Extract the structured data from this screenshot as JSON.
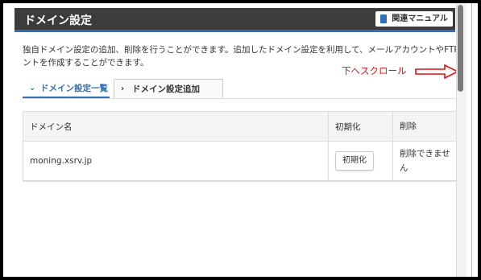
{
  "header": {
    "title": "ドメイン設定",
    "manual_label": "関連マニュアル"
  },
  "description": {
    "line1": "独自ドメイン設定の追加、削除を行うことができます。追加したドメイン設定を利用して、メールアカウントやFTPアカウ",
    "line2": "ントを作成することができます。"
  },
  "annotation": {
    "text": "下へスクロール",
    "color": "#dd1111"
  },
  "tabs": [
    {
      "label": "ドメイン設定一覧",
      "active": true
    },
    {
      "label": "ドメイン設定追加",
      "active": false
    }
  ],
  "table": {
    "headers": [
      "ドメイン名",
      "初期化",
      "削除"
    ],
    "rows": [
      {
        "domain": "moning.xsrv.jp",
        "init_button": "初期化",
        "delete_status": "削除できません"
      }
    ]
  },
  "colors": {
    "header_bg": "#3c3c3c",
    "accent": "#2e6fb7"
  }
}
